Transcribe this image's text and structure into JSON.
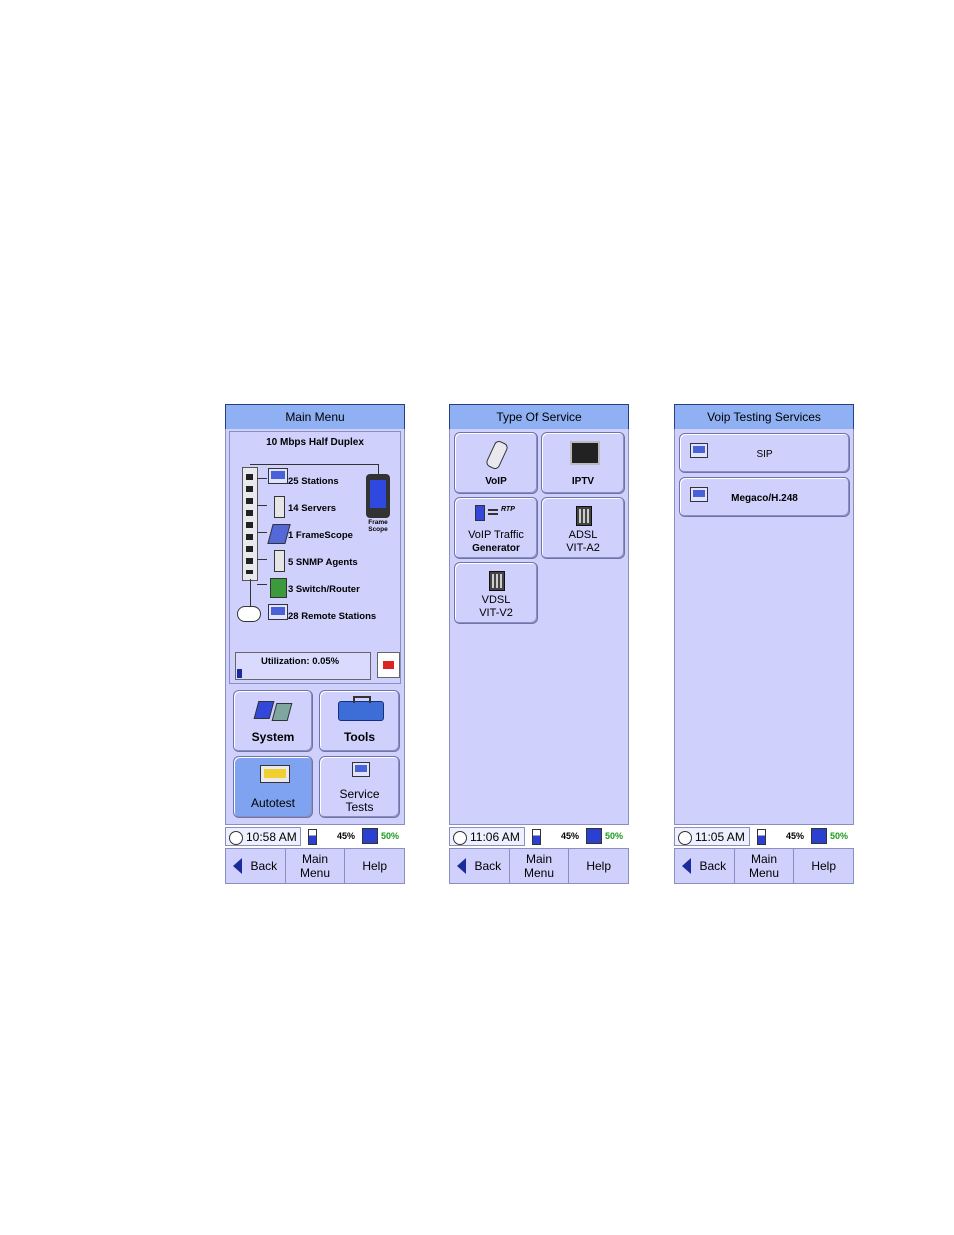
{
  "screens": [
    {
      "title": "Main Menu",
      "link_status": "10 Mbps Half Duplex",
      "network_items": [
        "25 Stations",
        "14 Servers",
        "1 FrameScope",
        "5 SNMP Agents",
        "3 Switch/Router",
        "28 Remote Stations"
      ],
      "framescope_label_1": "Frame",
      "framescope_label_2": "Scope",
      "utilization": "Utilization: 0.05%",
      "tiles": {
        "system": "System",
        "tools": "Tools",
        "autotest": "Autotest",
        "service_1": "Service",
        "service_2": "Tests"
      },
      "time": "10:58 AM",
      "battery": "45%",
      "storage": "50%",
      "nav": {
        "back": "Back",
        "main_1": "Main",
        "main_2": "Menu",
        "help": "Help"
      }
    },
    {
      "title": "Type Of Service",
      "tiles": {
        "voip": "VoIP",
        "iptv": "IPTV",
        "traffic_1": "VoIP Traffic",
        "traffic_2": "Generator",
        "rtp": "RTP",
        "adsl_1": "ADSL",
        "adsl_2": "VIT-A2",
        "vdsl_1": "VDSL",
        "vdsl_2": "VIT-V2"
      },
      "time": "11:06 AM",
      "battery": "45%",
      "storage": "50%",
      "nav": {
        "back": "Back",
        "main_1": "Main",
        "main_2": "Menu",
        "help": "Help"
      }
    },
    {
      "title": "Voip Testing Services",
      "items": [
        "SIP",
        "Megaco/H.248"
      ],
      "time": "11:05 AM",
      "battery": "45%",
      "storage": "50%",
      "nav": {
        "back": "Back",
        "main_1": "Main",
        "main_2": "Menu",
        "help": "Help"
      }
    }
  ],
  "colors": {
    "title_bg": "#8fb0f2",
    "panel_bg": "#cfd0fb",
    "selected_tile": "#7fa3f0",
    "storage_green": "#1a9a1a"
  }
}
